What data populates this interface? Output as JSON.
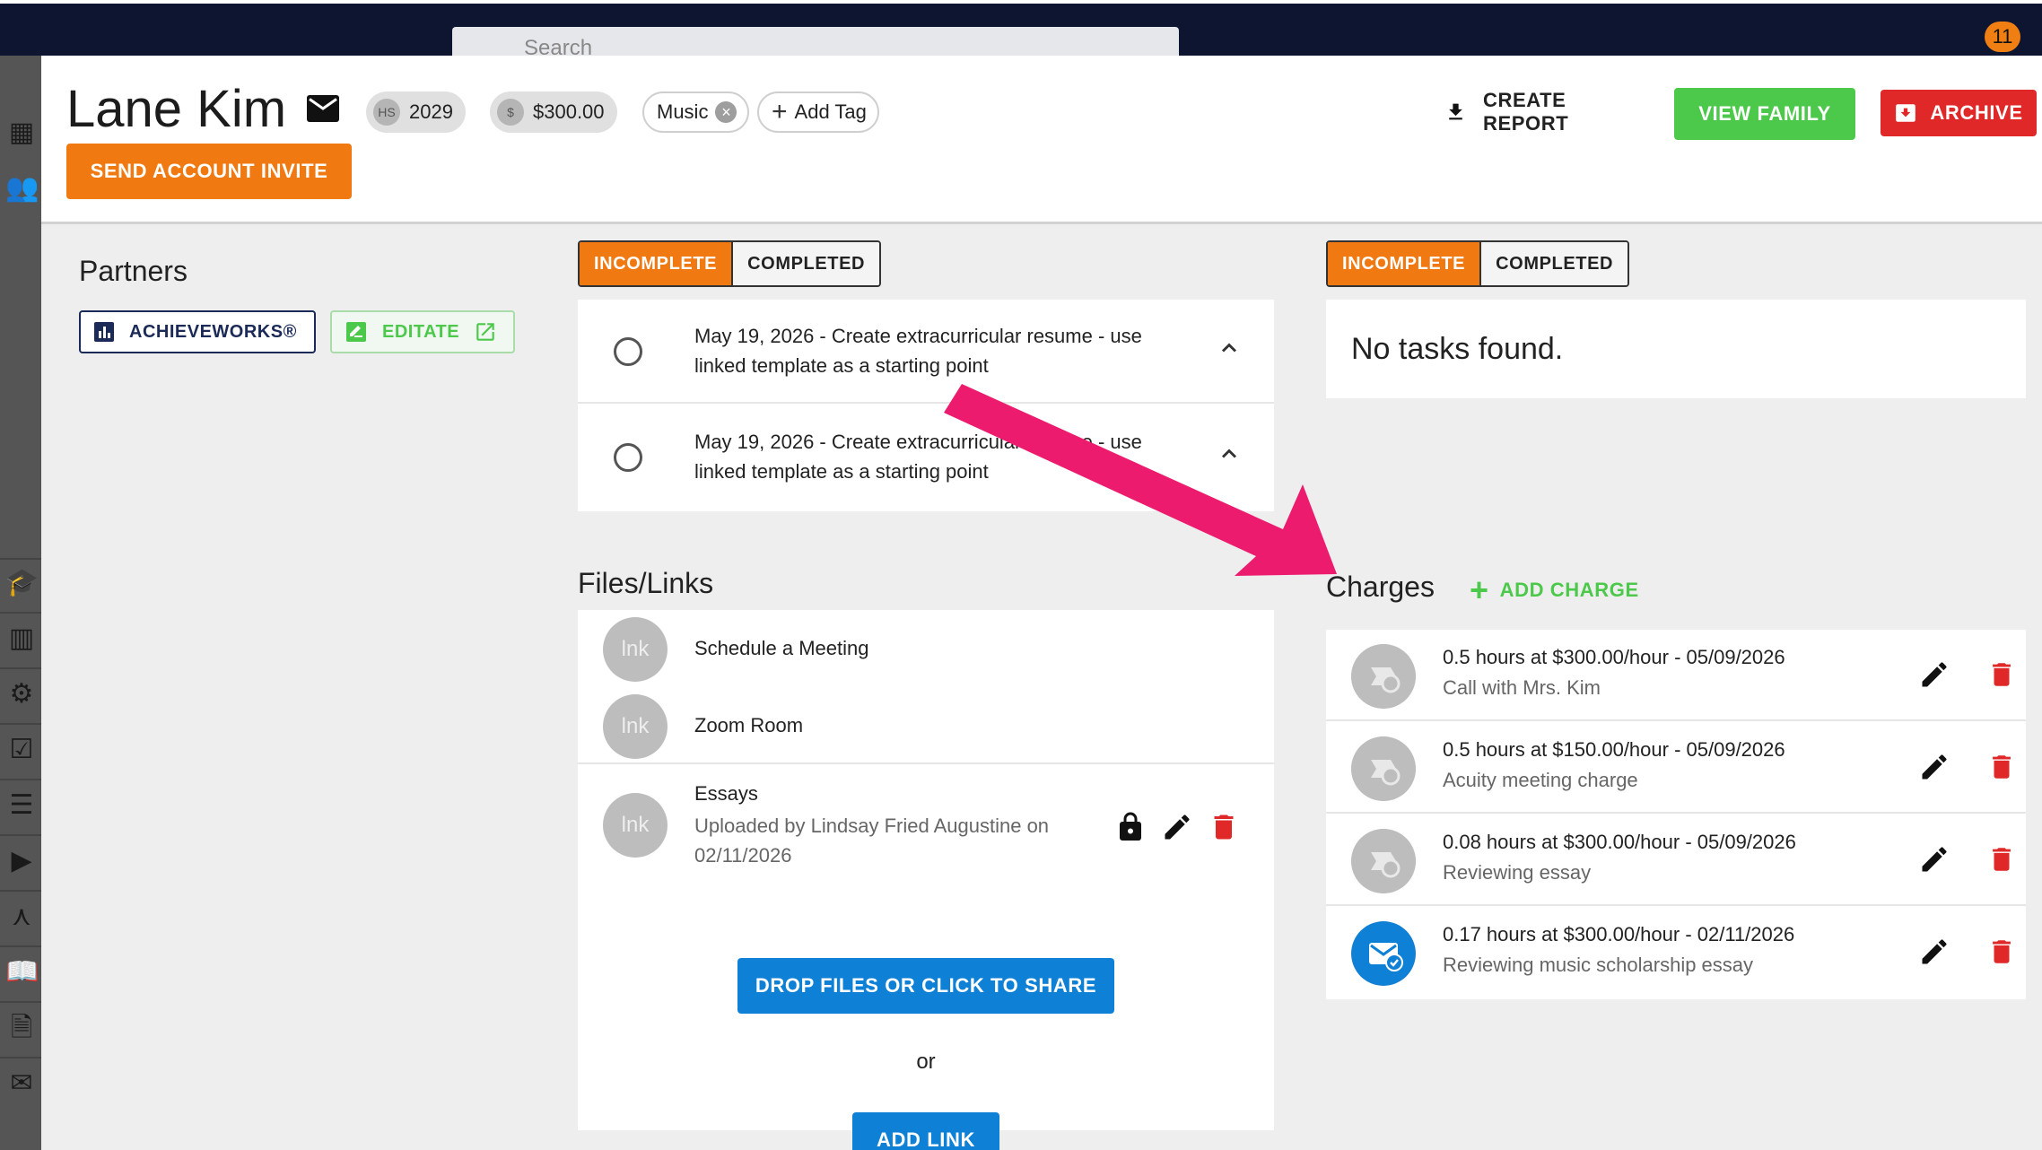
{
  "topbar": {
    "search_placeholder": "Search",
    "notification_count": "11"
  },
  "header": {
    "name": "Lane Kim",
    "chips": {
      "grad_avatar": "HS",
      "grad_year": "2029",
      "balance_avatar": "$",
      "balance": "$300.00",
      "tag": "Music",
      "add_tag": "Add Tag"
    },
    "send_invite": "SEND ACCOUNT INVITE",
    "create_report": "CREATE REPORT",
    "view_family": "VIEW FAMILY",
    "archive": "ARCHIVE"
  },
  "partners": {
    "title": "Partners",
    "items": [
      "ACHIEVEWORKS®",
      "EDITATE"
    ]
  },
  "tasks_left": {
    "tabs": [
      "INCOMPLETE",
      "COMPLETED"
    ],
    "items": [
      "May 19, 2026 - Create extracurricular resume - use linked template as a starting point",
      "May 19, 2026 - Create extracurricular resume - use linked template as a starting point"
    ]
  },
  "tasks_right": {
    "tabs": [
      "INCOMPLETE",
      "COMPLETED"
    ],
    "empty": "No tasks found."
  },
  "files": {
    "title": "Files/Links",
    "avatar": "lnk",
    "items": [
      {
        "title": "Schedule a Meeting"
      },
      {
        "title": "Zoom Room"
      },
      {
        "title": "Essays",
        "subtitle": "Uploaded by Lindsay Fried Augustine on 02/11/2026"
      }
    ],
    "drop_button": "DROP FILES OR CLICK TO SHARE",
    "or": "or",
    "add_link": "ADD LINK"
  },
  "charges": {
    "title": "Charges",
    "add": "ADD CHARGE",
    "items": [
      {
        "line": "0.5 hours at $300.00/hour - 05/09/2026",
        "desc": "Call with Mrs. Kim",
        "icon": "timer-icon"
      },
      {
        "line": "0.5 hours at $150.00/hour - 05/09/2026",
        "desc": "Acuity meeting charge",
        "icon": "timer-icon"
      },
      {
        "line": "0.08 hours at $300.00/hour - 05/09/2026",
        "desc": "Reviewing essay",
        "icon": "timer-icon"
      },
      {
        "line": "0.17 hours at $300.00/hour - 02/11/2026",
        "desc": "Reviewing music scholarship essay",
        "icon": "mail-check-icon"
      }
    ]
  },
  "colors": {
    "orange": "#f07911",
    "green": "#4cc94b",
    "red": "#e12828",
    "blue": "#0e80d6",
    "arrow": "#ec1b6e"
  }
}
